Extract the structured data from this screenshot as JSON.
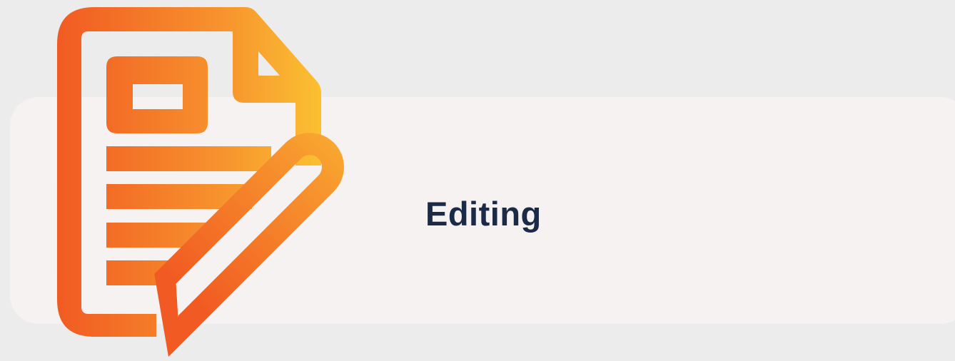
{
  "feature": {
    "label": "Editing",
    "icon": "document-edit-icon"
  },
  "colors": {
    "background": "#ececec",
    "card": "#f6f2f1",
    "label_text": "#1b2a47",
    "gradient_start": "#f15a22",
    "gradient_end": "#fcd333"
  }
}
